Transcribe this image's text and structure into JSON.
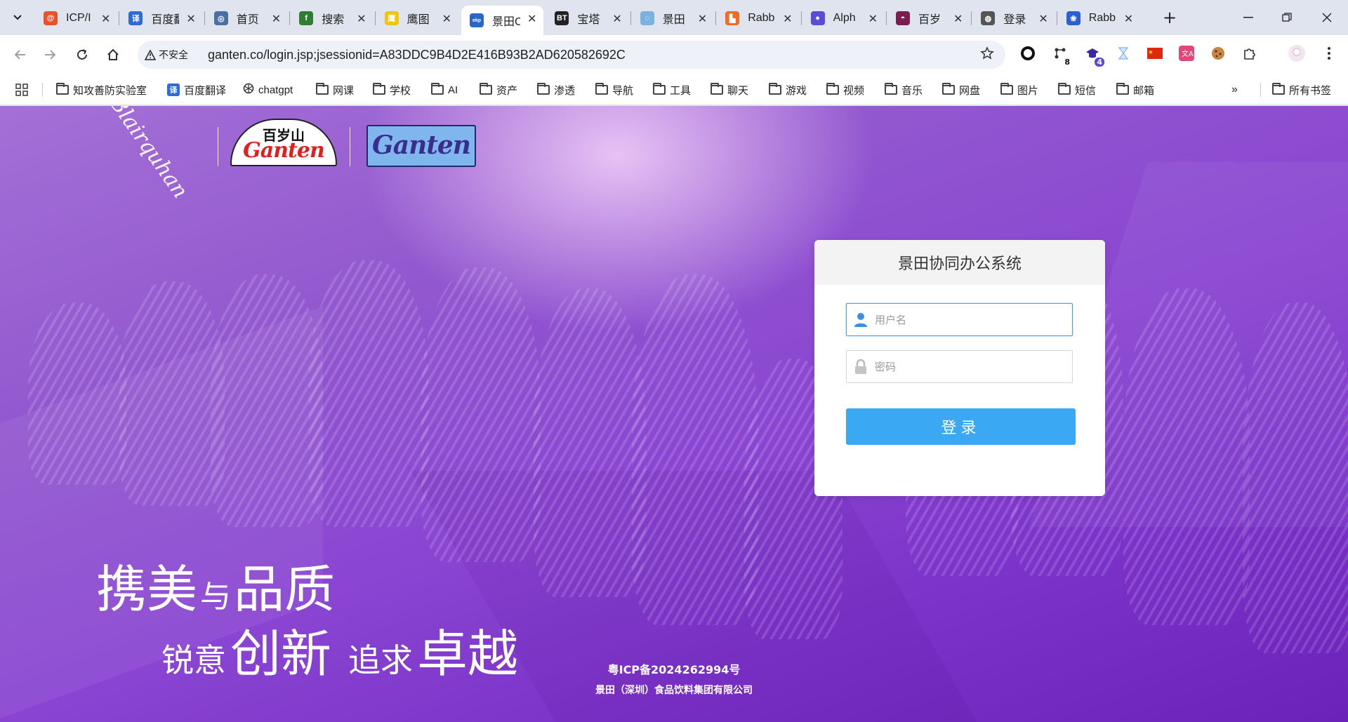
{
  "browser": {
    "tabs": [
      {
        "label": "ICP/I",
        "icon": "icp-icon",
        "color": "#e8532b"
      },
      {
        "label": "百度翻",
        "icon": "baidu-translate-icon",
        "color": "#2f6bd6"
      },
      {
        "label": "首页",
        "icon": "eye-icon",
        "color": "#4a6fa5"
      },
      {
        "label": "搜索",
        "icon": "search-f-icon",
        "color": "#2e7d32"
      },
      {
        "label": "鹰图",
        "icon": "hawk-icon",
        "color": "#f1c40f"
      },
      {
        "label": "景田C",
        "icon": "ekp-icon",
        "color": "#2a66c9"
      },
      {
        "label": "宝塔",
        "icon": "bt-icon",
        "color": "#222222"
      },
      {
        "label": "景田",
        "icon": "swirl-icon",
        "color": "#7bb3e0"
      },
      {
        "label": "Rabb",
        "icon": "rabbit-orange-icon",
        "color": "#f26b21"
      },
      {
        "label": "Alph",
        "icon": "alpha-icon",
        "color": "#5b4bd6"
      },
      {
        "label": "百岁",
        "icon": "bsh-icon",
        "color": "#7a1d4f"
      },
      {
        "label": "登录",
        "icon": "globe-icon",
        "color": "#555555"
      },
      {
        "label": "Rabb",
        "icon": "paw-icon",
        "color": "#2b5fd6"
      }
    ],
    "address": {
      "security_label": "不安全",
      "url": "ganten.co/login.jsp;jsessionid=A83DDC9B4D2E416B93B2AD620582692C"
    },
    "extensions": [
      {
        "name": "circle-extension-icon",
        "badge": ""
      },
      {
        "name": "network-extension-icon",
        "badge": "8"
      },
      {
        "name": "hat-extension-icon",
        "badge": "4"
      },
      {
        "name": "hourglass-extension-icon",
        "badge": ""
      },
      {
        "name": "china-flag-extension-icon",
        "badge": ""
      },
      {
        "name": "translate-extension-icon",
        "badge": ""
      },
      {
        "name": "cookie-extension-icon",
        "badge": ""
      },
      {
        "name": "puzzle-extension-icon",
        "badge": ""
      },
      {
        "name": "profile-avatar-icon",
        "badge": ""
      },
      {
        "name": "menu-more-icon",
        "badge": ""
      }
    ],
    "bookmarks": [
      {
        "label": "知攻善防实验室",
        "type": "folder"
      },
      {
        "label": "百度翻译",
        "type": "site"
      },
      {
        "label": "chatgpt",
        "type": "site"
      },
      {
        "label": "网课",
        "type": "folder"
      },
      {
        "label": "学校",
        "type": "folder"
      },
      {
        "label": "AI",
        "type": "folder"
      },
      {
        "label": "资产",
        "type": "folder"
      },
      {
        "label": "渗透",
        "type": "folder"
      },
      {
        "label": "导航",
        "type": "folder"
      },
      {
        "label": "工具",
        "type": "folder"
      },
      {
        "label": "聊天",
        "type": "folder"
      },
      {
        "label": "游戏",
        "type": "folder"
      },
      {
        "label": "视频",
        "type": "folder"
      },
      {
        "label": "音乐",
        "type": "folder"
      },
      {
        "label": "网盘",
        "type": "folder"
      },
      {
        "label": "图片",
        "type": "folder"
      },
      {
        "label": "短信",
        "type": "folder"
      },
      {
        "label": "邮箱",
        "type": "folder"
      }
    ],
    "all_bookmarks_label": "所有书签"
  },
  "page": {
    "logos": {
      "bsh_top": "百岁山",
      "bsh_brand": "Ganten",
      "gt_brand": "Ganten"
    },
    "login": {
      "title": "景田协同办公系统",
      "username_placeholder": "用户名",
      "password_placeholder": "密码",
      "button_label": "登录"
    },
    "slogan": {
      "line1_a": "携美",
      "line1_b": "与",
      "line1_c": "品质",
      "line2_a": "锐意",
      "line2_b": "创新",
      "line2_c": "追求",
      "line2_d": "卓越"
    },
    "footer": {
      "icp": "粤ICP备2024262994号",
      "company": "景田（深圳）食品饮料集团有限公司"
    },
    "colors": {
      "accent": "#3aa8f3",
      "background": "#8a45d2"
    }
  }
}
